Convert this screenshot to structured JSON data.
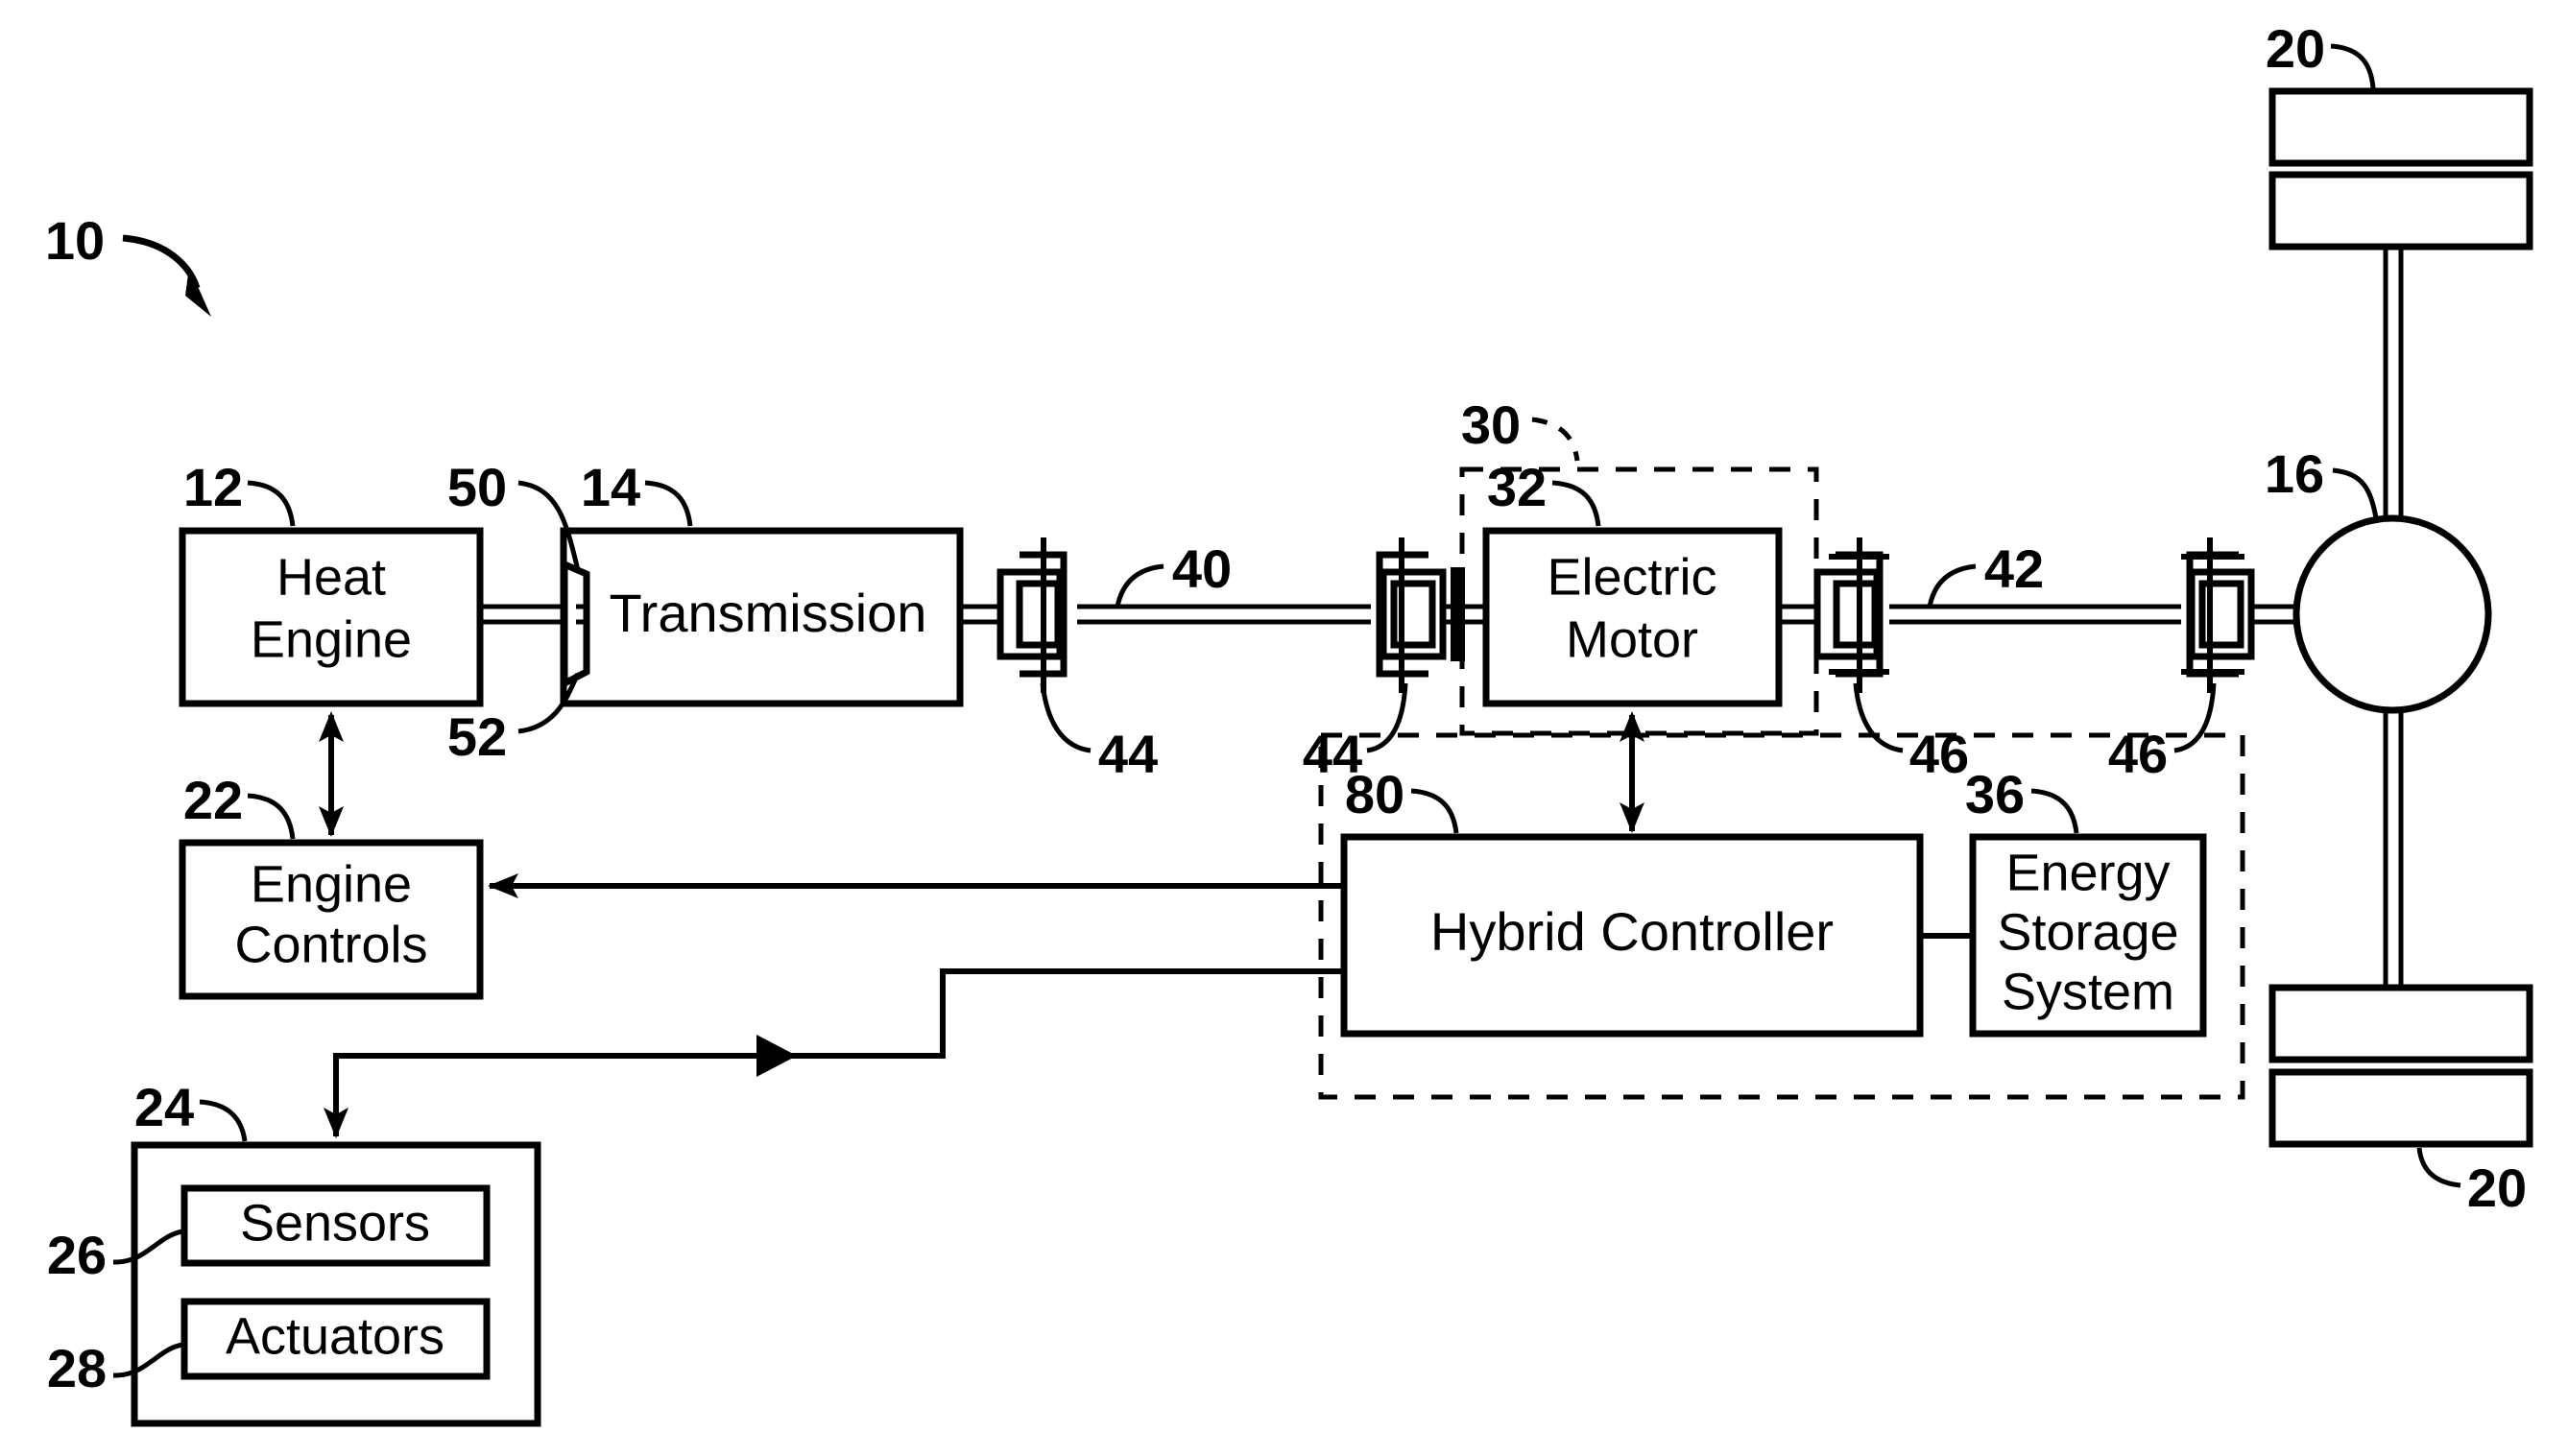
{
  "figure": {
    "title_ref": "10",
    "blocks": {
      "heat_engine": {
        "label_line1": "Heat",
        "label_line2": "Engine",
        "ref": "12"
      },
      "transmission": {
        "label": "Transmission",
        "ref": "14"
      },
      "electric_motor": {
        "label_line1": "Electric",
        "label_line2": "Motor",
        "ref": "32"
      },
      "engine_controls": {
        "label_line1": "Engine",
        "label_line2": "Controls",
        "ref": "22"
      },
      "hybrid_controller": {
        "label": "Hybrid Controller",
        "ref": "80"
      },
      "energy_storage": {
        "label_line1": "Energy",
        "label_line2": "Storage",
        "label_line3": "System",
        "ref": "36"
      },
      "sensor_actuator_module": {
        "ref": "24"
      },
      "sensors": {
        "label": "Sensors",
        "ref": "26"
      },
      "actuators": {
        "label": "Actuators",
        "ref": "28"
      },
      "differential": {
        "ref": "16"
      },
      "wheel_top": {
        "ref": "20"
      },
      "wheel_bottom": {
        "ref": "20"
      },
      "electric_drive_group": {
        "ref": "30"
      }
    },
    "couplings": {
      "clutch_input": {
        "ref": "50"
      },
      "clutch_output": {
        "ref": "52"
      },
      "driveshaft_front": {
        "ref": "40"
      },
      "driveshaft_rear": {
        "ref": "42"
      },
      "ujoint_front_left": {
        "ref": "44"
      },
      "ujoint_front_right": {
        "ref": "44"
      },
      "ujoint_rear_left": {
        "ref": "46"
      },
      "ujoint_rear_right": {
        "ref": "46"
      }
    }
  }
}
